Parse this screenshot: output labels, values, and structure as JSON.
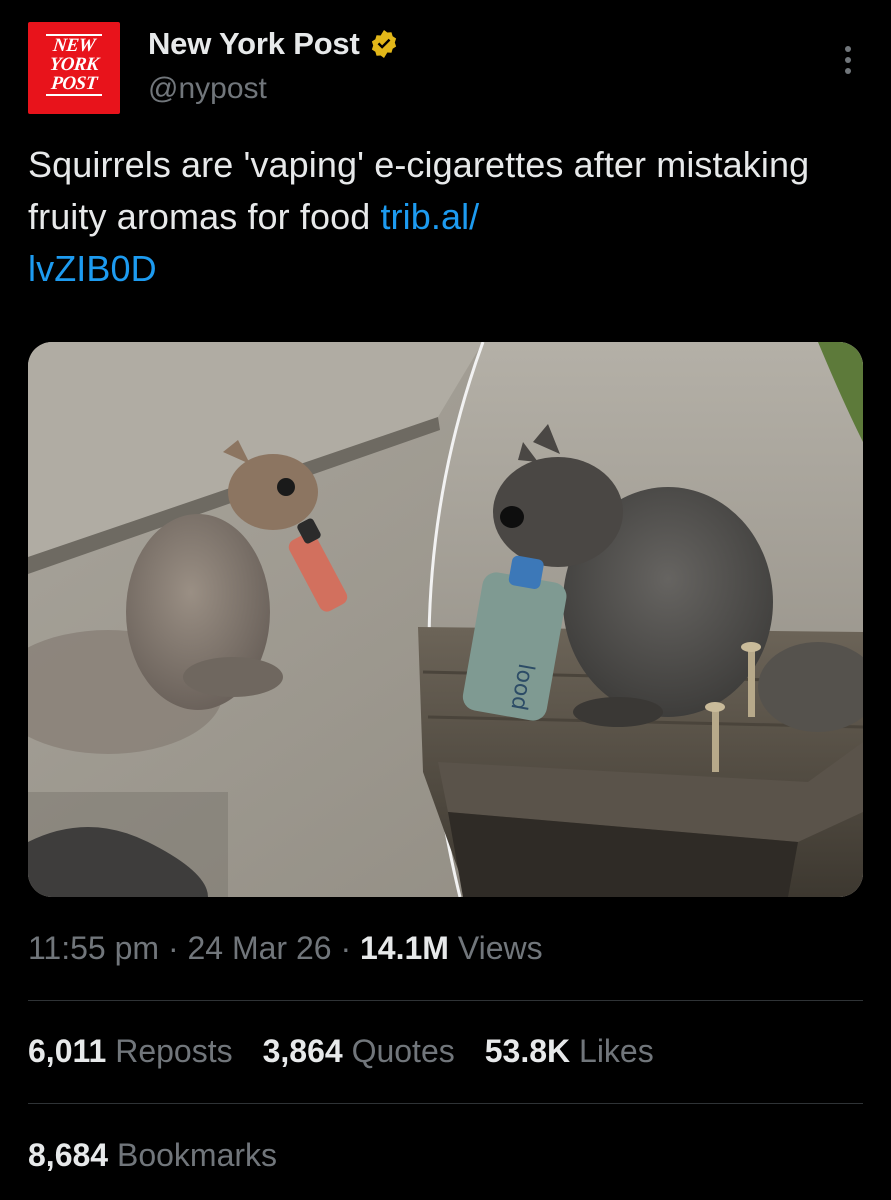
{
  "account": {
    "logo_lines": [
      "NEW",
      "YORK",
      "POST"
    ],
    "display_name": "New York Post",
    "handle": "@nypost",
    "verified_color": "#e2b719"
  },
  "tweet": {
    "text": "Squirrels are 'vaping' e-cigarettes after mistaking fruity aromas for food ",
    "link_line1": "trib.al/",
    "link_line2": "lvZIB0D",
    "link_color": "#1d9bf0"
  },
  "media": {
    "icon": "photo-collage",
    "vape_label": "lood"
  },
  "meta": {
    "time": "11:55 pm",
    "sep": " · ",
    "date": "24 Mar 26",
    "views_count": "14.1M",
    "views_label": " Views"
  },
  "stats": {
    "reposts_count": "6,011",
    "reposts_label": " Reposts",
    "quotes_count": "3,864",
    "quotes_label": " Quotes",
    "likes_count": "53.8K",
    "likes_label": " Likes",
    "bookmarks_count": "8,684",
    "bookmarks_label": " Bookmarks"
  },
  "colors": {
    "background": "#000000",
    "text_primary": "#e7e9ea",
    "text_secondary": "#71767b",
    "divider": "#2f3336",
    "brand_red": "#e8131b"
  }
}
